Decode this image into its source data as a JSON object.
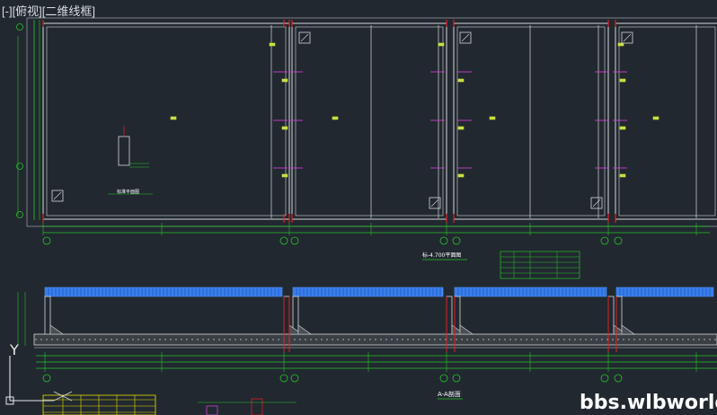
{
  "viewport": {
    "menu_minus": "[-]",
    "menu_view": "[俯视]",
    "menu_style": "[二维线框]"
  },
  "plan": {
    "title": "标-4.700平面图",
    "sub_label": "标准平面图",
    "grid_bubbles": [
      "①",
      "⑤",
      "⑥",
      "⑩",
      "⑪",
      "⑬",
      "⑭"
    ]
  },
  "section": {
    "title": "A-A剖面"
  },
  "ucs": {
    "y_label": "Y"
  },
  "watermark": {
    "text": "bbs.wlbworld.com"
  },
  "colors": {
    "background": "#212830",
    "wall": "#d8d8d8",
    "dimension": "#27c427",
    "grid_axis": "#e02020",
    "rebar_mark": "#d040d0",
    "beam_top": "#2a6fe0",
    "annotation": "#c8e040"
  }
}
